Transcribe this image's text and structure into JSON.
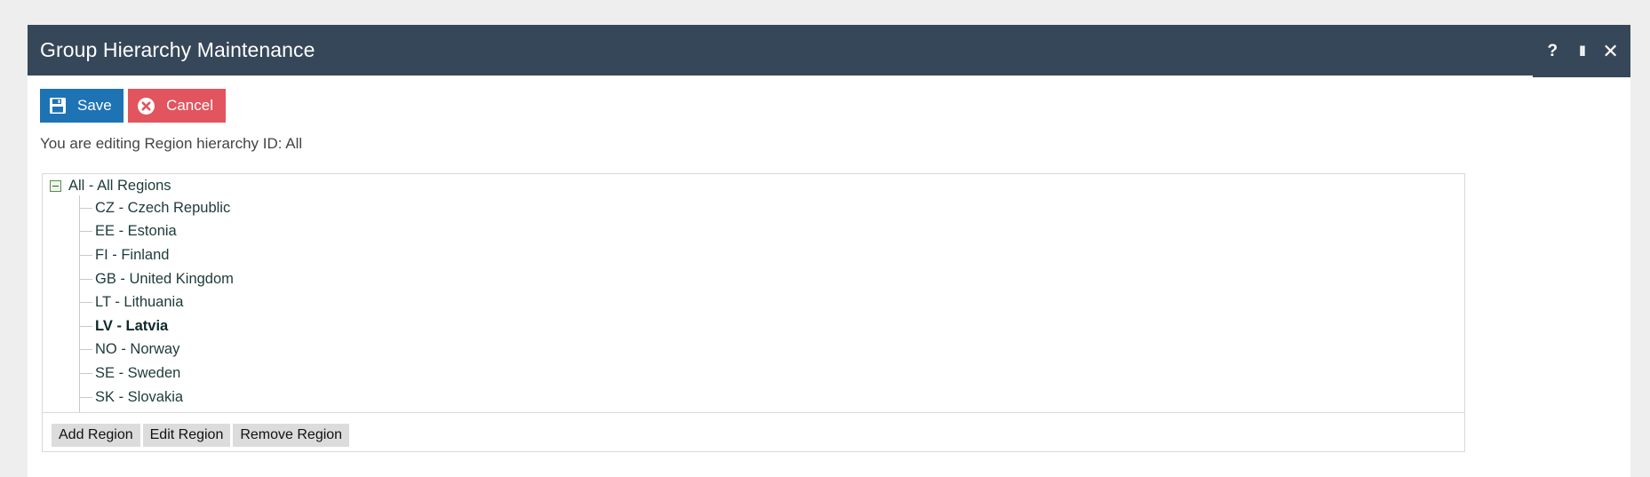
{
  "dialog": {
    "title": "Group Hierarchy Maintenance",
    "help_label": "?",
    "pause_label": "II",
    "close_label": "✕"
  },
  "toolbar": {
    "save_label": "Save",
    "cancel_label": "Cancel",
    "save_icon": "floppy-disk-icon",
    "cancel_icon": "x-circle-icon"
  },
  "editing_text": "You are editing Region hierarchy ID: All",
  "tree": {
    "root_label": "All - All Regions",
    "children": [
      {
        "label": "CZ - Czech Republic",
        "selected": false
      },
      {
        "label": "EE - Estonia",
        "selected": false
      },
      {
        "label": "FI - Finland",
        "selected": false
      },
      {
        "label": "GB - United Kingdom",
        "selected": false
      },
      {
        "label": "LT - Lithuania",
        "selected": false
      },
      {
        "label": "LV - Latvia",
        "selected": true
      },
      {
        "label": "NO - Norway",
        "selected": false
      },
      {
        "label": "SE - Sweden",
        "selected": false
      },
      {
        "label": "SK - Slovakia",
        "selected": false
      }
    ]
  },
  "panel_buttons": {
    "add_label": "Add Region",
    "edit_label": "Edit Region",
    "remove_label": "Remove Region"
  },
  "colors": {
    "titlebar": "#364759",
    "save": "#1e73b4",
    "cancel": "#e2545e"
  }
}
